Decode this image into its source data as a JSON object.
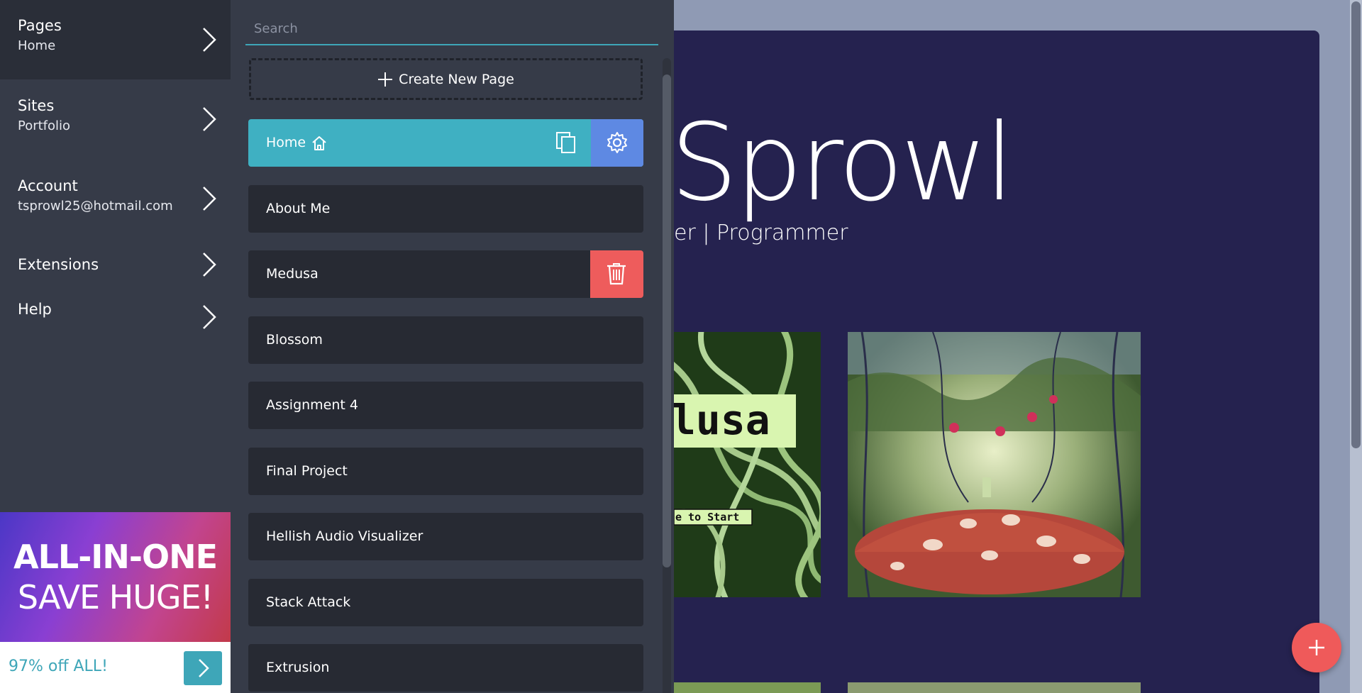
{
  "nav": {
    "pages": {
      "title": "Pages",
      "sub": "Home"
    },
    "sites": {
      "title": "Sites",
      "sub": "Portfolio"
    },
    "account": {
      "title": "Account",
      "sub": "tsprowl25@hotmail.com"
    },
    "extensions": {
      "title": "Extensions"
    },
    "help": {
      "title": "Help"
    }
  },
  "promo": {
    "line1": "ALL-IN-ONE",
    "line2": "SAVE HUGE!",
    "offer": "97% off ALL!"
  },
  "panel": {
    "search_placeholder": "Search",
    "create_label": "Create New Page",
    "pages": [
      "Home",
      "About Me",
      "Medusa",
      "Blossom",
      "Assignment 4",
      "Final Project",
      "Hellish Audio Visualizer",
      "Stack Attack",
      "Extrusion"
    ]
  },
  "site": {
    "hero": "Sprowl",
    "tagline": "er | Programmer",
    "thumb1_text": "lusa",
    "thumb1_sub": "e to Start"
  },
  "colors": {
    "nav_bg": "#363b48",
    "accent": "#3fb0c2",
    "gear_bg": "#5e89e3",
    "delete_bg": "#ee5c5c",
    "site_bg": "#25224f"
  }
}
